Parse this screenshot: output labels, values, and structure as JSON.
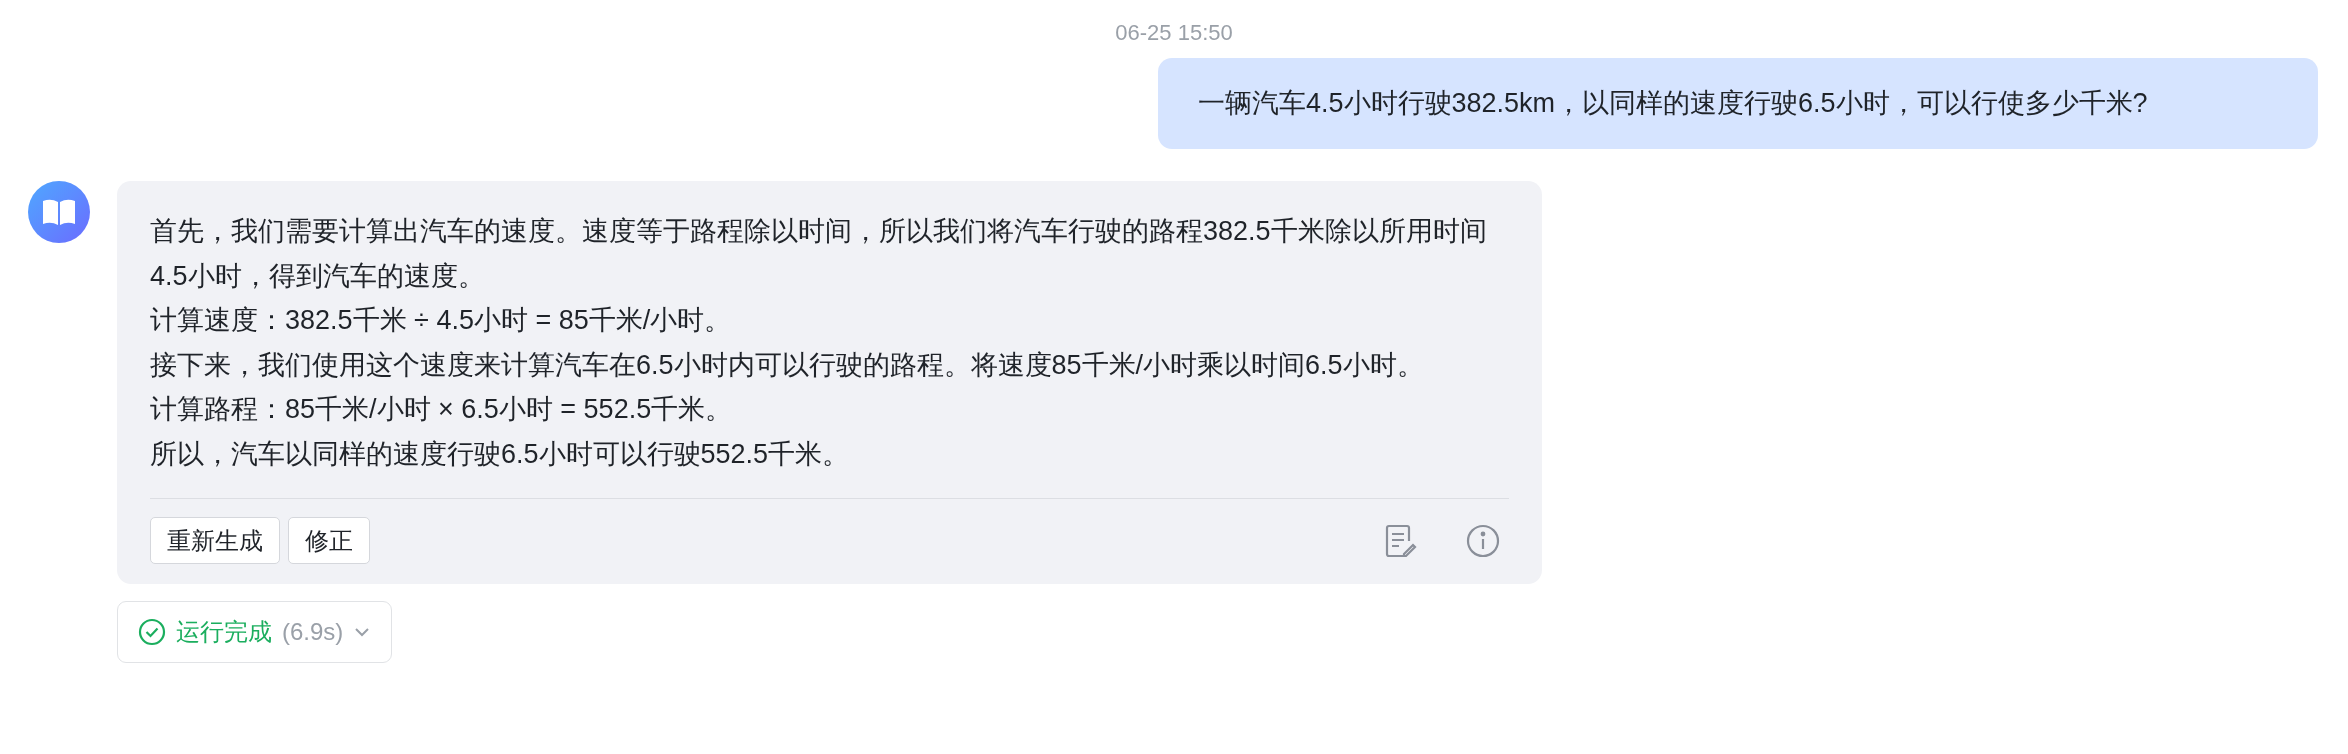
{
  "timestamp": "06-25 15:50",
  "user_message": "一辆汽车4.5小时行驶382.5km，以同样的速度行驶6.5小时，可以行使多少千米?",
  "reply": {
    "paragraphs": [
      "首先，我们需要计算出汽车的速度。速度等于路程除以时间，所以我们将汽车行驶的路程382.5千米除以所用时间4.5小时，得到汽车的速度。",
      "计算速度：382.5千米 ÷ 4.5小时 = 85千米/小时。",
      "接下来，我们使用这个速度来计算汽车在6.5小时内可以行驶的路程。将速度85千米/小时乘以时间6.5小时。",
      "计算路程：85千米/小时 × 6.5小时 = 552.5千米。",
      "所以，汽车以同样的速度行驶6.5小时可以行驶552.5千米。"
    ],
    "buttons": [
      "重新生成",
      "修正"
    ]
  },
  "run_status": {
    "label": "运行完成",
    "duration": "(6.9s)",
    "expanded": false
  }
}
